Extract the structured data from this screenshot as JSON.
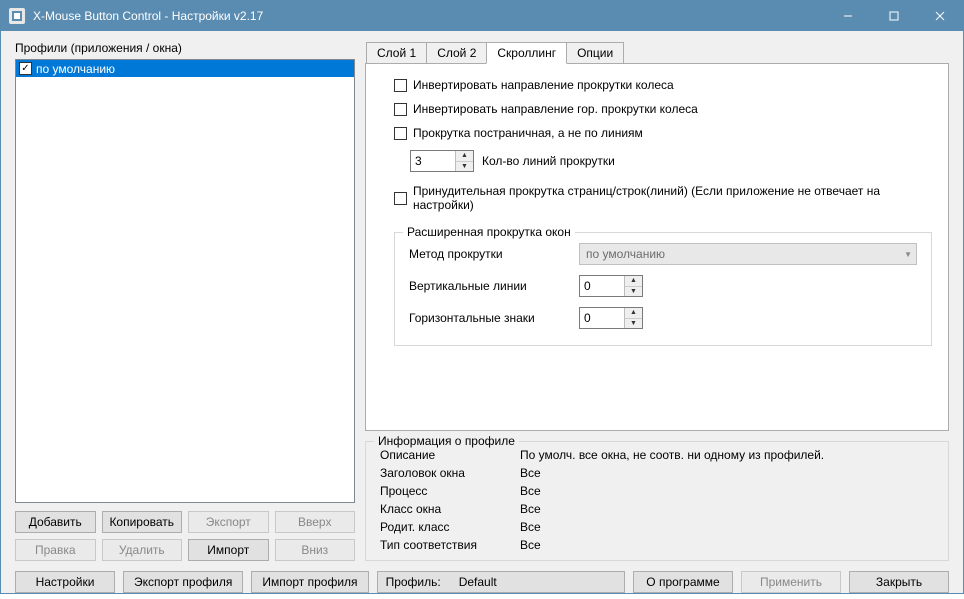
{
  "window": {
    "title": "X-Mouse Button Control - Настройки v2.17"
  },
  "left": {
    "label": "Профили (приложения / окна)",
    "profiles": [
      {
        "name": "по умолчанию",
        "checked": true,
        "selected": true
      }
    ],
    "buttons": {
      "add": "Добавить",
      "copy": "Копировать",
      "export": "Экспорт",
      "up": "Вверх",
      "edit": "Правка",
      "delete": "Удалить",
      "import": "Импорт",
      "down": "Вниз"
    }
  },
  "tabs": {
    "layer1": "Слой 1",
    "layer2": "Слой 2",
    "scrolling": "Скроллинг",
    "options": "Опции"
  },
  "scroll": {
    "invert_wheel": "Инвертировать направление прокрутки колеса",
    "invert_hwheel": "Инвертировать направление гор. прокрутки колеса",
    "page_scroll": "Прокрутка постраничная, а не по линиям",
    "lines_value": "3",
    "lines_label": "Кол-во линий прокрутки",
    "force_scroll": "Принудительная прокрутка страниц/строк(линий) (Если приложение не отвечает на настройки)",
    "adv_legend": "Расширенная прокрутка окон",
    "method_label": "Метод прокрутки",
    "method_value": "по умолчанию",
    "vlines_label": "Вертикальные линии",
    "vlines_value": "0",
    "hchars_label": "Горизонтальные знаки",
    "hchars_value": "0"
  },
  "info": {
    "legend": "Информация о профиле",
    "desc_label": "Описание",
    "desc_value": "По умолч. все окна, не соотв. ни одному из профилей.",
    "wtitle_label": "Заголовок окна",
    "wtitle_value": "Все",
    "proc_label": "Процесс",
    "proc_value": "Все",
    "wclass_label": "Класс окна",
    "wclass_value": "Все",
    "pclass_label": "Родит. класс",
    "pclass_value": "Все",
    "match_label": "Тип соответствия",
    "match_value": "Все"
  },
  "bottom": {
    "settings": "Настройки",
    "export_profile": "Экспорт профиля",
    "import_profile": "Импорт профиля",
    "profile_label": "Профиль:",
    "profile_value": "Default",
    "about": "О программе",
    "apply": "Применить",
    "close": "Закрыть"
  }
}
